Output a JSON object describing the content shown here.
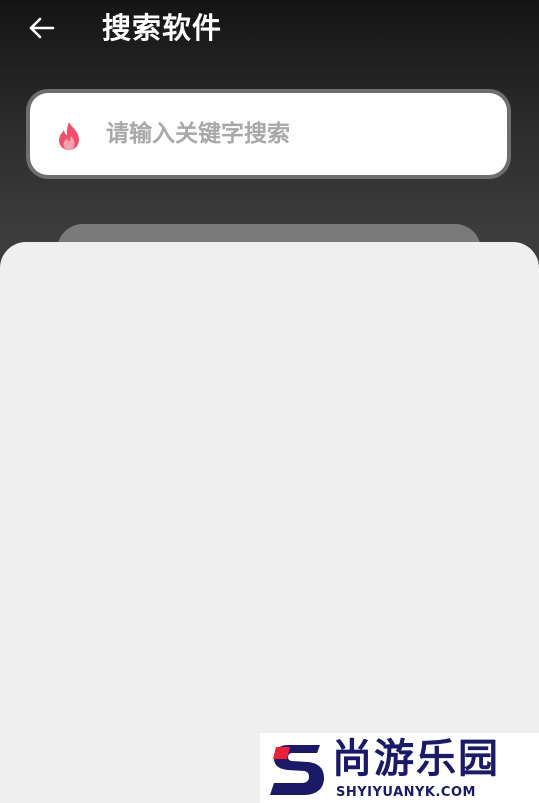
{
  "header": {
    "back_icon": "arrow-left-icon",
    "title": "搜索软件"
  },
  "search": {
    "icon": "flame-icon",
    "placeholder": "请输入关键字搜索",
    "value": ""
  },
  "watermark": {
    "brand": "尚游乐园",
    "url": "SHYIYUANYK.COM",
    "logo_letter": "S"
  },
  "colors": {
    "accent": "#f0506e",
    "title": "#ffffff",
    "sheet": "#efefef",
    "watermark": "#1a1a66",
    "watermark_red": "#e8203a"
  }
}
